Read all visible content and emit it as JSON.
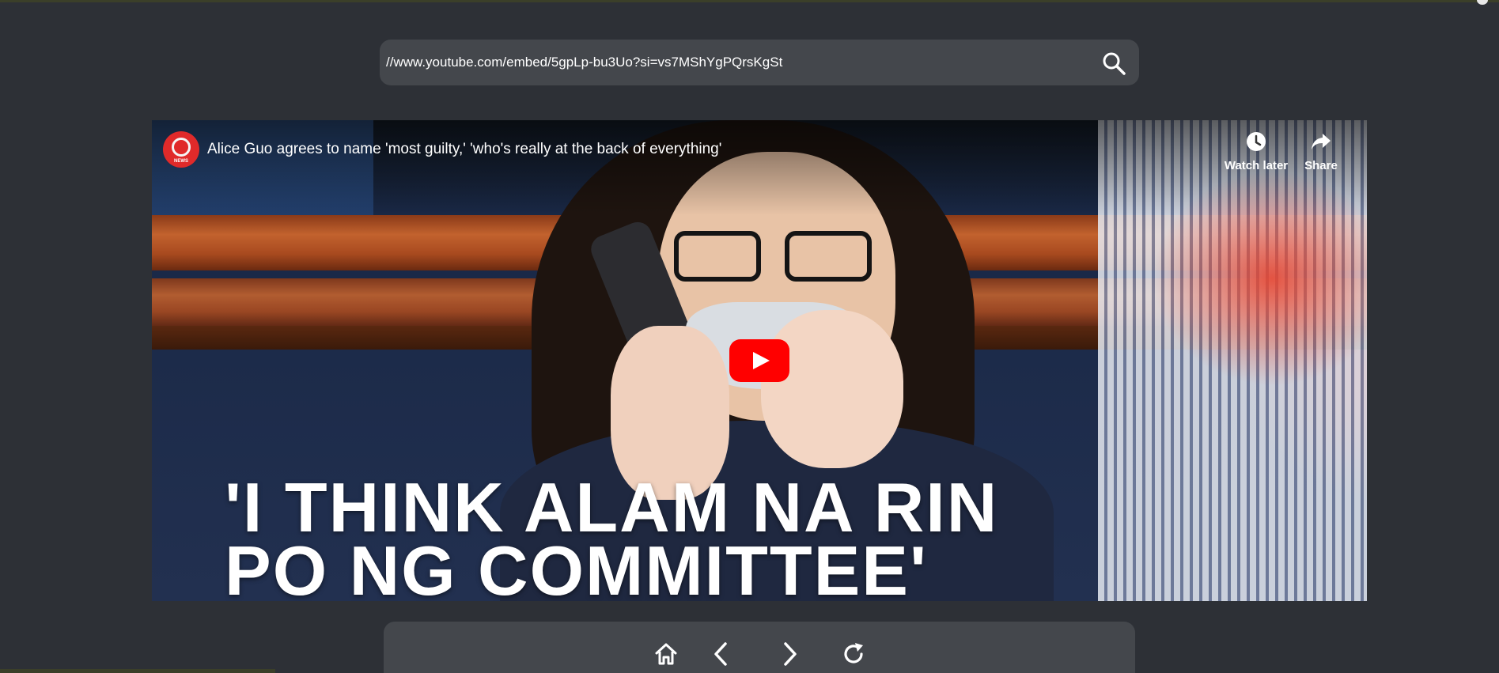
{
  "address_bar": {
    "url": "//www.youtube.com/embed/5gpLp-bu3Uo?si=vs7MShYgPQrsKgSt",
    "search_icon": "search-icon"
  },
  "video": {
    "title": "Alice Guo agrees to name 'most guilty,' 'who's really at the back of everything'",
    "channel_logo_text": "NEWS",
    "watch_later_label": "Watch later",
    "share_label": "Share",
    "caption_line1": "'I THINK ALAM NA RIN",
    "caption_line2": "PO NG COMMITTEE'",
    "play_icon": "youtube-play-icon",
    "play_color": "#ff0000"
  },
  "navigation": {
    "home_icon": "home-icon",
    "back_icon": "chevron-left-icon",
    "forward_icon": "chevron-right-icon",
    "reload_icon": "reload-icon"
  },
  "colors": {
    "background": "#2d3036",
    "panel": "#44474c",
    "text": "#ffffff"
  }
}
